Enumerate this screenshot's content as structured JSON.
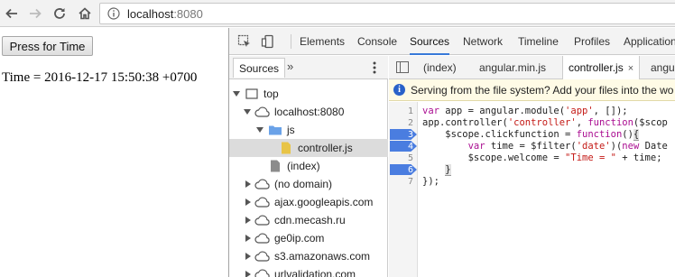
{
  "browser": {
    "url_host": "localhost",
    "url_port": ":8080"
  },
  "page": {
    "button_label": "Press for Time",
    "time_text": "Time = 2016-12-17 15:50:38 +0700"
  },
  "devtools": {
    "tabs": [
      "Elements",
      "Console",
      "Sources",
      "Network",
      "Timeline",
      "Profiles",
      "Application"
    ],
    "active_tab": "Sources",
    "navigator": {
      "tab_label": "Sources",
      "more_label": "»",
      "tree": [
        {
          "label": "top",
          "icon": "frame-icon",
          "depth": 0,
          "expanded": true
        },
        {
          "label": "localhost:8080",
          "icon": "cloud-icon",
          "depth": 1,
          "expanded": true
        },
        {
          "label": "js",
          "icon": "folder-icon",
          "depth": 2,
          "expanded": true
        },
        {
          "label": "controller.js",
          "icon": "js-file-icon",
          "depth": 3,
          "selected": true
        },
        {
          "label": "(index)",
          "icon": "file-icon",
          "depth": 2
        },
        {
          "label": "(no domain)",
          "icon": "cloud-icon",
          "depth": 1,
          "collapsed": true
        },
        {
          "label": "ajax.googleapis.com",
          "icon": "cloud-icon",
          "depth": 1,
          "collapsed": true
        },
        {
          "label": "cdn.mecash.ru",
          "icon": "cloud-icon",
          "depth": 1,
          "collapsed": true
        },
        {
          "label": "ge0ip.com",
          "icon": "cloud-icon",
          "depth": 1,
          "collapsed": true
        },
        {
          "label": "s3.amazonaws.com",
          "icon": "cloud-icon",
          "depth": 1,
          "collapsed": true
        },
        {
          "label": "urlvalidation.com",
          "icon": "cloud-icon",
          "depth": 1,
          "collapsed": true
        }
      ]
    },
    "editor": {
      "tabs": [
        {
          "label": "(index)",
          "active": false
        },
        {
          "label": "angular.min.js",
          "active": false
        },
        {
          "label": "controller.js",
          "active": true,
          "close": "×"
        },
        {
          "label": "angula",
          "active": false
        }
      ],
      "infobar_text": "Serving from the file system? Add your files into the wo",
      "info_icon": "i",
      "line_numbers": [
        "1",
        "2",
        "3",
        "4",
        "5",
        "6",
        "7"
      ],
      "breakpoint_lines": [
        3,
        4,
        6
      ],
      "code": {
        "l1_kw": "var",
        "l1_a": " app = angular.module(",
        "l1_str": "'app'",
        "l1_b": ", []);",
        "l2_a": "app.controller(",
        "l2_str": "'controller'",
        "l2_b": ", ",
        "l2_kw": "function",
        "l2_c": "($scop",
        "l3_a": "    $scope.clickfunction = ",
        "l3_kw": "function",
        "l3_b": "()",
        "l3_brace": "{",
        "l4_a": "        ",
        "l4_kw": "var",
        "l4_b": " time = $filter(",
        "l4_str": "'date'",
        "l4_c": ")(",
        "l4_kw2": "new",
        "l4_d": " Date",
        "l5_a": "        $scope.welcome = ",
        "l5_str": "\"Time = \"",
        "l5_b": " + time;",
        "l6_a": "    ",
        "l6_brace": "}",
        "l7_a": "});"
      }
    }
  }
}
